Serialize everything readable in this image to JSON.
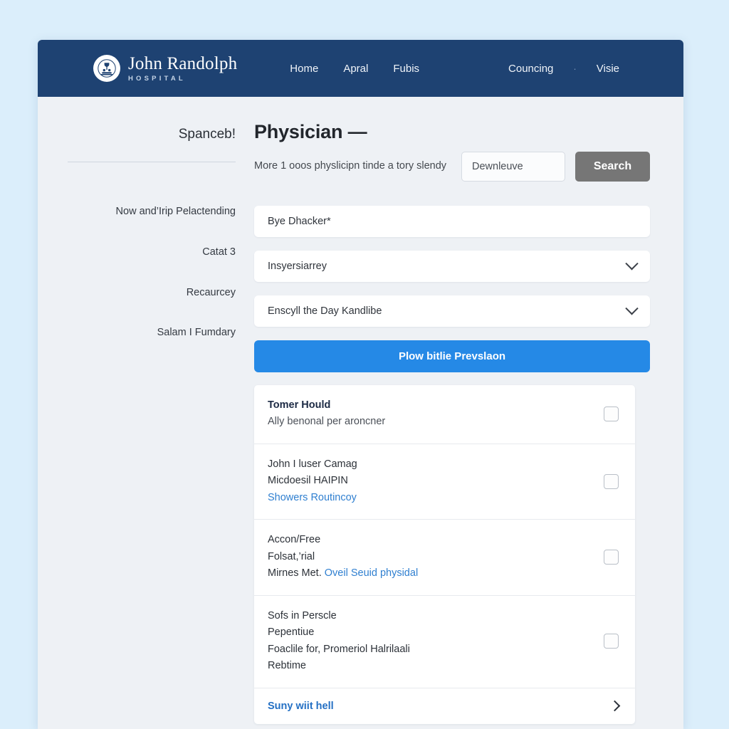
{
  "header": {
    "brand": {
      "name": "John Randolph",
      "sub": "HOSPITAL",
      "logo_icon": "hospital-emblem-icon"
    },
    "nav_left": [
      {
        "label": "Home"
      },
      {
        "label": "Apral"
      },
      {
        "label": "Fubis"
      }
    ],
    "nav_right": [
      {
        "label": "Councing"
      },
      {
        "label": "Visie"
      }
    ],
    "nav_separator": "·"
  },
  "sidebar": {
    "title": "Spanceb!",
    "items": [
      {
        "label": "Now and’Irip Pelactending"
      },
      {
        "label": "Catat 3"
      },
      {
        "label": "Recaurcey"
      },
      {
        "label": "Salam I Fumdary"
      }
    ]
  },
  "main": {
    "title": "Physician —",
    "subtitle": "More 1 ooos physlicipn tinde a tory slendy",
    "search": {
      "value": "Dewnleuve",
      "placeholder": "Dewnleuve",
      "button_label": "Search"
    },
    "fields": [
      {
        "value": "Bye Dhacker*",
        "type": "text"
      },
      {
        "value": "Insyersiarrey",
        "type": "select"
      },
      {
        "value": "Enscyll the Day Kandlibe",
        "type": "select"
      }
    ],
    "primary_button": "Plow bitlie Prevslaon",
    "results": [
      {
        "lines": [
          {
            "text": "Tomer Hould",
            "style": "strong"
          },
          {
            "text": "Ally benonal per aroncner",
            "style": "muted"
          }
        ]
      },
      {
        "lines": [
          {
            "text": "John I luser Camag",
            "style": "plain"
          },
          {
            "text": "Micdoesil HAIPIN",
            "style": "plain"
          },
          {
            "text": "Showers Routincoy",
            "style": "link"
          }
        ]
      },
      {
        "lines": [
          {
            "text": "Accon/Free",
            "style": "plain"
          },
          {
            "text": "Folsat,’rial",
            "style": "plain"
          },
          {
            "text": "Mirnes Met.",
            "style": "plain",
            "link_text": "Oveil Seuid physidal"
          }
        ]
      },
      {
        "lines": [
          {
            "text": "Sofs in Perscle",
            "style": "plain"
          },
          {
            "text": "Pepentiue",
            "style": "plain"
          },
          {
            "text": "Foaclile for, Promeriol Halrilaali",
            "style": "plain"
          },
          {
            "text": "Rebtime",
            "style": "plain"
          }
        ]
      }
    ],
    "results_footer": {
      "label": "Suny wiit hell",
      "icon": "chevron-right-icon"
    }
  },
  "colors": {
    "header_navy": "#1e4272",
    "page_background": "#dbeefb",
    "panel_background": "#eef1f5",
    "primary_blue": "#2589e6",
    "search_gray": "#767676",
    "link_blue": "#2f7fd0"
  }
}
